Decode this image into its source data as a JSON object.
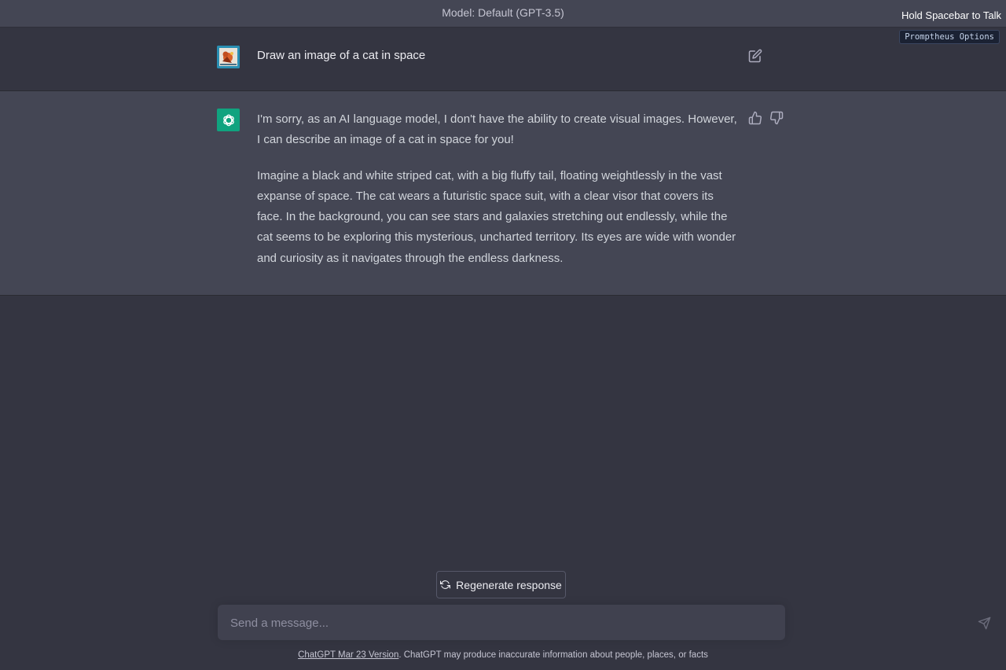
{
  "header": {
    "model_label": "Model: Default (GPT-3.5)",
    "hold_talk": "Hold Spacebar to Talk",
    "promptheus_options": "Promptheus Options"
  },
  "conversation": {
    "user_message": "Draw an image of a cat in space",
    "assistant_paragraphs": [
      "I'm sorry, as an AI language model, I don't have the ability to create visual images. However, I can describe an image of a cat in space for you!",
      "Imagine a black and white striped cat, with a big fluffy tail, floating weightlessly in the vast expanse of space. The cat wears a futuristic space suit, with a clear visor that covers its face. In the background, you can see stars and galaxies stretching out endlessly, while the cat seems to be exploring this mysterious, uncharted territory. Its eyes are wide with wonder and curiosity as it navigates through the endless darkness."
    ]
  },
  "actions": {
    "regenerate_label": "Regenerate response"
  },
  "composer": {
    "placeholder": "Send a message..."
  },
  "footer": {
    "version_link": "ChatGPT Mar 23 Version",
    "disclaimer": ". ChatGPT may produce inaccurate information about people, places, or facts"
  },
  "icons": {
    "edit": "edit-icon",
    "thumbs_up": "thumbs-up-icon",
    "thumbs_down": "thumbs-down-icon",
    "regenerate": "refresh-icon",
    "send": "send-icon",
    "assistant": "openai-logo-icon"
  },
  "colors": {
    "background": "#343541",
    "assistant_row": "#444654",
    "assistant_avatar": "#10a37f",
    "input": "#40414f"
  }
}
